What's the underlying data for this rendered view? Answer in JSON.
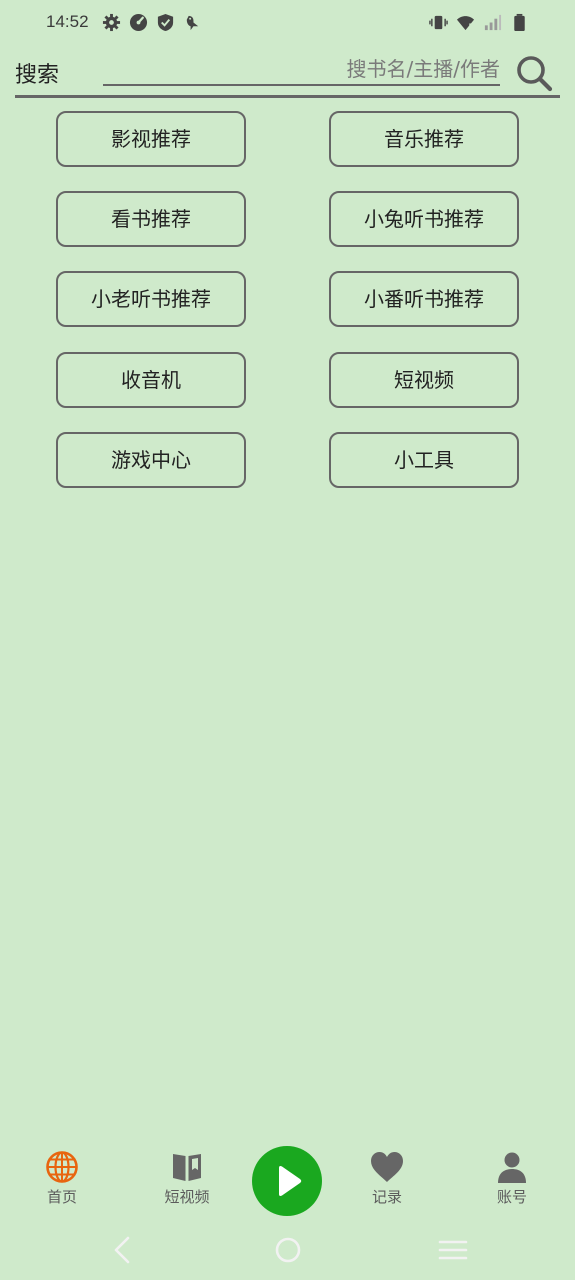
{
  "status_bar": {
    "time": "14:52",
    "left_icons": [
      "gear-icon",
      "speedometer-icon",
      "shield-icon",
      "bird-icon"
    ],
    "right_icons": [
      "vibrate-icon",
      "wifi-icon",
      "signal-icon",
      "battery-icon"
    ]
  },
  "search": {
    "label": "搜索",
    "placeholder": "搜书名/主播/作者",
    "value": ""
  },
  "categories": [
    {
      "label": "影视推荐"
    },
    {
      "label": "音乐推荐"
    },
    {
      "label": "看书推荐"
    },
    {
      "label": "小兔听书推荐"
    },
    {
      "label": "小老听书推荐"
    },
    {
      "label": "小番听书推荐"
    },
    {
      "label": "收音机"
    },
    {
      "label": "短视频"
    },
    {
      "label": "游戏中心"
    },
    {
      "label": "小工具"
    }
  ],
  "bottom_nav": {
    "items": [
      {
        "label": "首页",
        "icon": "globe-icon",
        "active": true
      },
      {
        "label": "短视频",
        "icon": "book-icon",
        "active": false
      },
      {
        "label": "",
        "icon": "play-icon",
        "active": false
      },
      {
        "label": "记录",
        "icon": "heart-icon",
        "active": false
      },
      {
        "label": "账号",
        "icon": "user-icon",
        "active": false
      }
    ]
  },
  "colors": {
    "background": "#cfeacb",
    "border": "#666666",
    "accent_orange": "#e8650f",
    "play_green": "#1aa81f",
    "nav_gray": "#5c5c5c"
  }
}
